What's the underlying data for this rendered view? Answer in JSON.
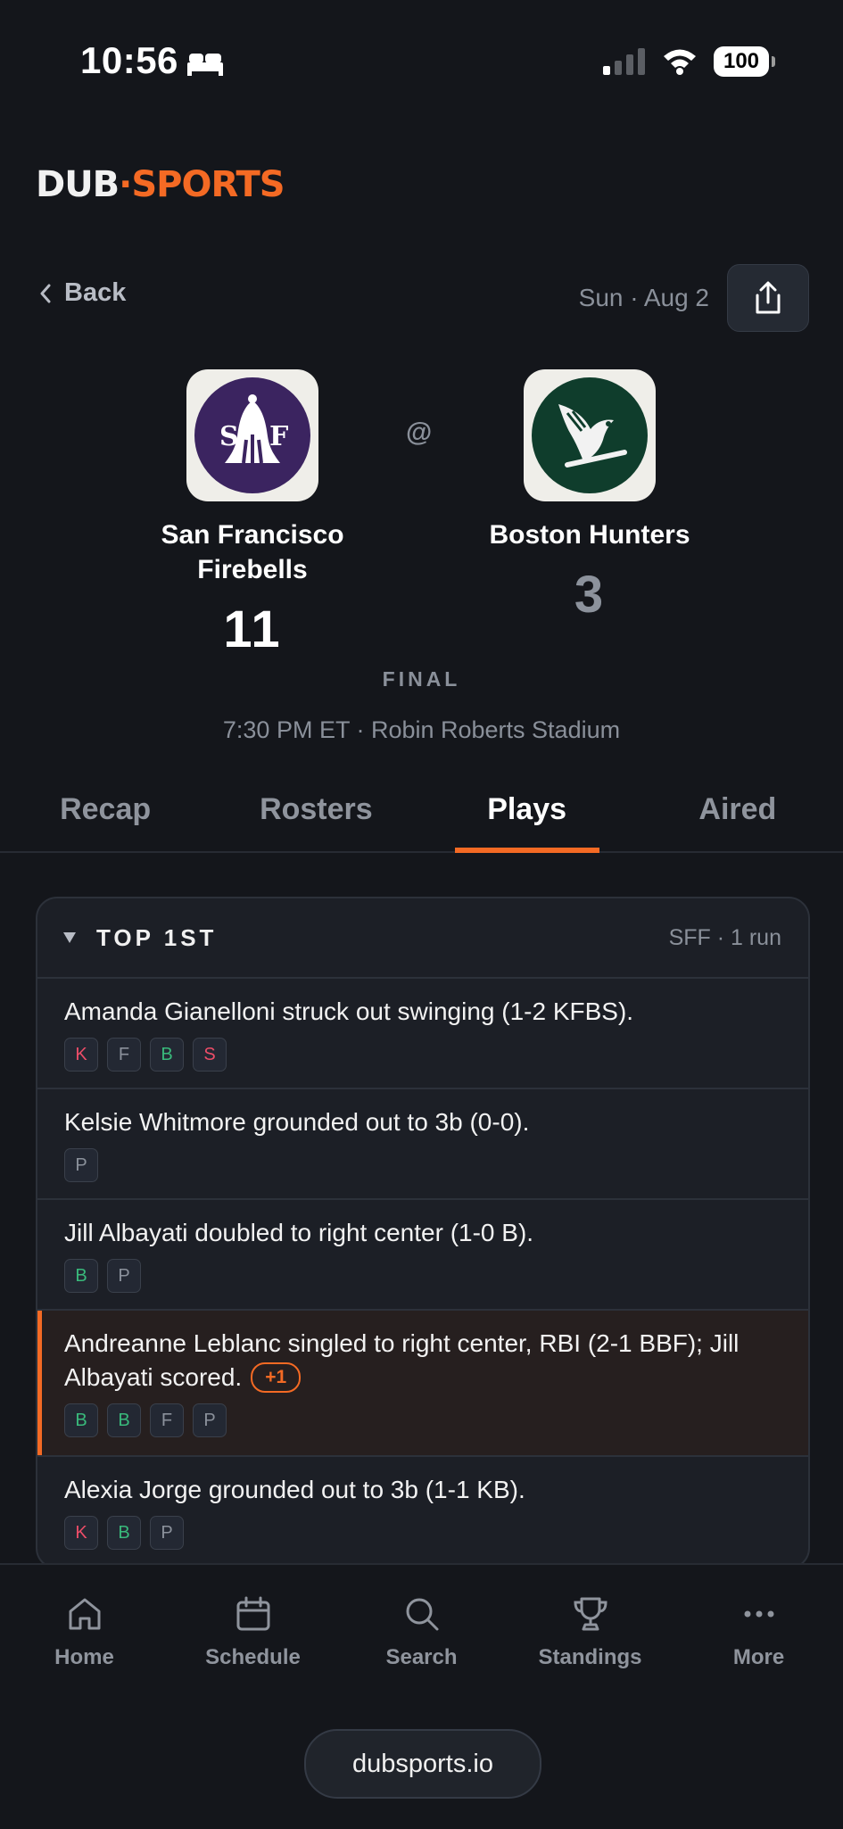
{
  "status_bar": {
    "time": "10:56",
    "battery": "100"
  },
  "brand": {
    "part1": "DUB",
    "separator": "·",
    "part2": "SPORTS",
    "accent": "#f46a24"
  },
  "nav": {
    "back_label": "Back",
    "date": "Sun · Aug 2"
  },
  "game": {
    "home": {
      "name": "San Francisco Firebells",
      "score": "11",
      "logo_letters": [
        "S",
        "F"
      ],
      "color": "#3b2460"
    },
    "away": {
      "name": "Boston Hunters",
      "score": "3",
      "color": "#0f3d2c"
    },
    "at": "@",
    "status": "FINAL",
    "venue": "7:30 PM ET · Robin Roberts Stadium"
  },
  "tabs": [
    {
      "label": "Recap"
    },
    {
      "label": "Rosters"
    },
    {
      "label": "Plays",
      "active": true
    },
    {
      "label": "Aired"
    }
  ],
  "plays": {
    "inning": "TOP 1ST",
    "summary": "SFF · 1 run",
    "items": [
      {
        "text": "Amanda Gianelloni struck out swinging (1-2 KFBS).",
        "pitches": [
          "K",
          "F",
          "B",
          "S"
        ]
      },
      {
        "text": "Kelsie Whitmore grounded out to 3b (0-0).",
        "pitches": [
          "P"
        ]
      },
      {
        "text": "Jill Albayati doubled to right center (1-0 B).",
        "pitches": [
          "B",
          "P"
        ]
      },
      {
        "text": "Andreanne Leblanc singled to right center, RBI (2-1 BBF); Jill Albayati scored.",
        "badge": "+1",
        "pitches": [
          "B",
          "B",
          "F",
          "P"
        ]
      },
      {
        "text": "Alexia Jorge grounded out to 3b (1-1 KB).",
        "pitches": [
          "K",
          "B",
          "P"
        ]
      }
    ]
  },
  "bottom_nav": [
    {
      "label": "Home",
      "icon": "home-icon"
    },
    {
      "label": "Schedule",
      "icon": "calendar-icon"
    },
    {
      "label": "Search",
      "icon": "search-icon"
    },
    {
      "label": "Standings",
      "icon": "trophy-icon"
    },
    {
      "label": "More",
      "icon": "more-icon"
    }
  ],
  "footer": {
    "site": "dubsports.io"
  }
}
